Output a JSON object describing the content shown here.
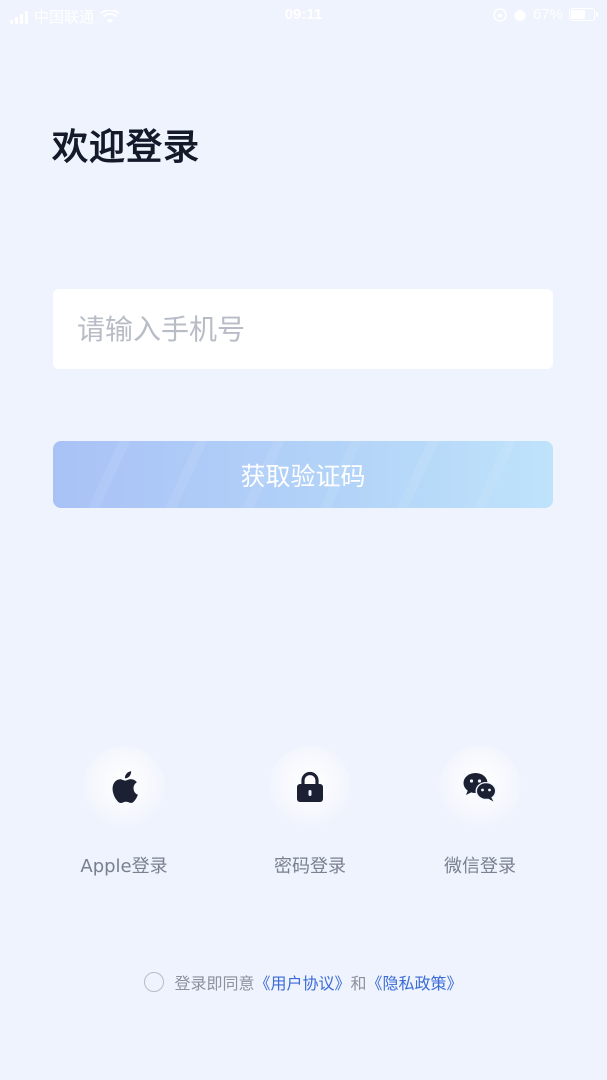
{
  "status_bar": {
    "carrier": "中国联通",
    "time": "09:11",
    "battery": "67%",
    "battery_level": 0.67
  },
  "title": "欢迎登录",
  "phone_input": {
    "placeholder": "请输入手机号",
    "value": ""
  },
  "get_code_button": {
    "label": "获取验证码"
  },
  "login_options": [
    {
      "label": "Apple登录",
      "icon": "apple-icon"
    },
    {
      "label": "密码登录",
      "icon": "lock-icon"
    },
    {
      "label": "微信登录",
      "icon": "wechat-icon"
    }
  ],
  "agreement": {
    "prefix": "登录即同意",
    "user_agreement": "《用户协议》",
    "conjunction": "和",
    "privacy_policy": "《隐私政策》"
  },
  "colors": {
    "background": "#eef3fd",
    "link": "#3a6bd6",
    "button_start": "#a9c2f6",
    "button_end": "#bfe3fb"
  }
}
